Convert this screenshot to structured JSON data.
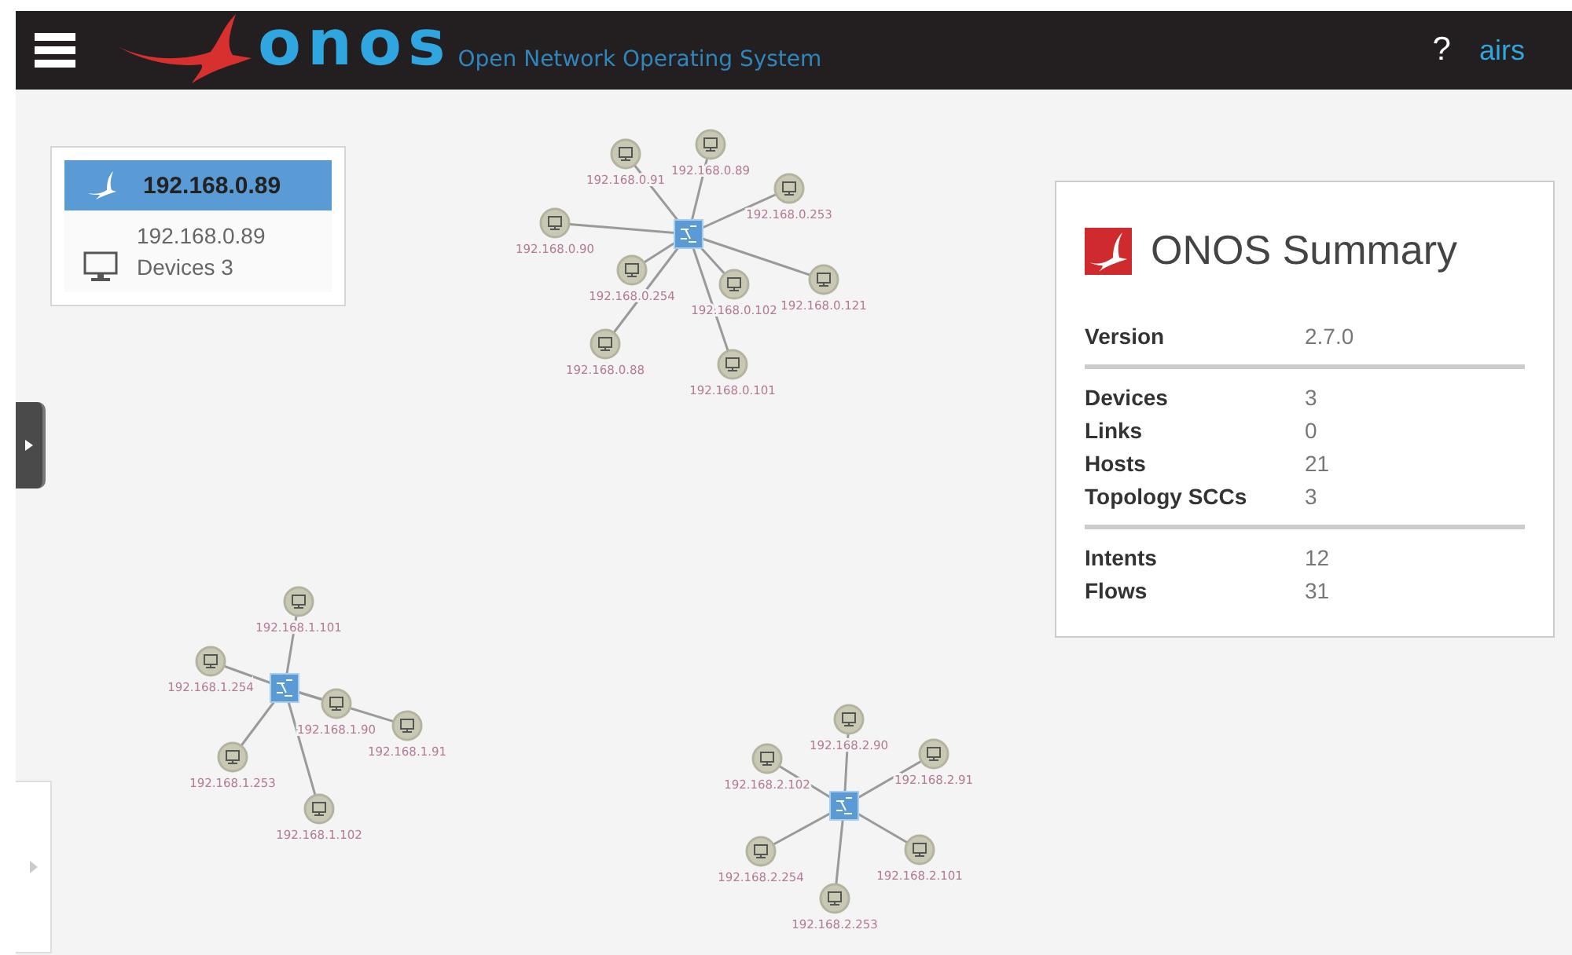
{
  "header": {
    "logo": "onos",
    "subtitle": "Open Network Operating System",
    "help": "?",
    "user": "airs"
  },
  "instance_panel": {
    "instances": [
      {
        "name": "192.168.0.89",
        "selected": true,
        "ip": "192.168.0.89",
        "devices": "Devices 3"
      }
    ]
  },
  "summary": {
    "title": "ONOS Summary",
    "sections": [
      [
        {
          "label": "Version",
          "value": "2.7.0"
        }
      ],
      [
        {
          "label": "Devices",
          "value": "3"
        },
        {
          "label": "Links",
          "value": "0"
        },
        {
          "label": "Hosts",
          "value": "21"
        },
        {
          "label": "Topology SCCs",
          "value": "3"
        }
      ],
      [
        {
          "label": "Intents",
          "value": "12"
        },
        {
          "label": "Flows",
          "value": "31"
        }
      ]
    ]
  },
  "topology": {
    "clusters": [
      {
        "hosts": [
          "192.168.0.91",
          "192.168.0.89",
          "192.168.0.253",
          "192.168.0.90",
          "192.168.0.254",
          "192.168.0.102",
          "192.168.0.121",
          "192.168.0.88",
          "192.168.0.101"
        ]
      },
      {
        "hosts": [
          "192.168.1.101",
          "192.168.1.254",
          "192.168.1.90",
          "192.168.1.91",
          "192.168.1.253",
          "192.168.1.102"
        ]
      },
      {
        "hosts": [
          "192.168.2.90",
          "192.168.2.102",
          "192.168.2.91",
          "192.168.2.254",
          "192.168.2.101",
          "192.168.2.253"
        ]
      }
    ]
  }
}
